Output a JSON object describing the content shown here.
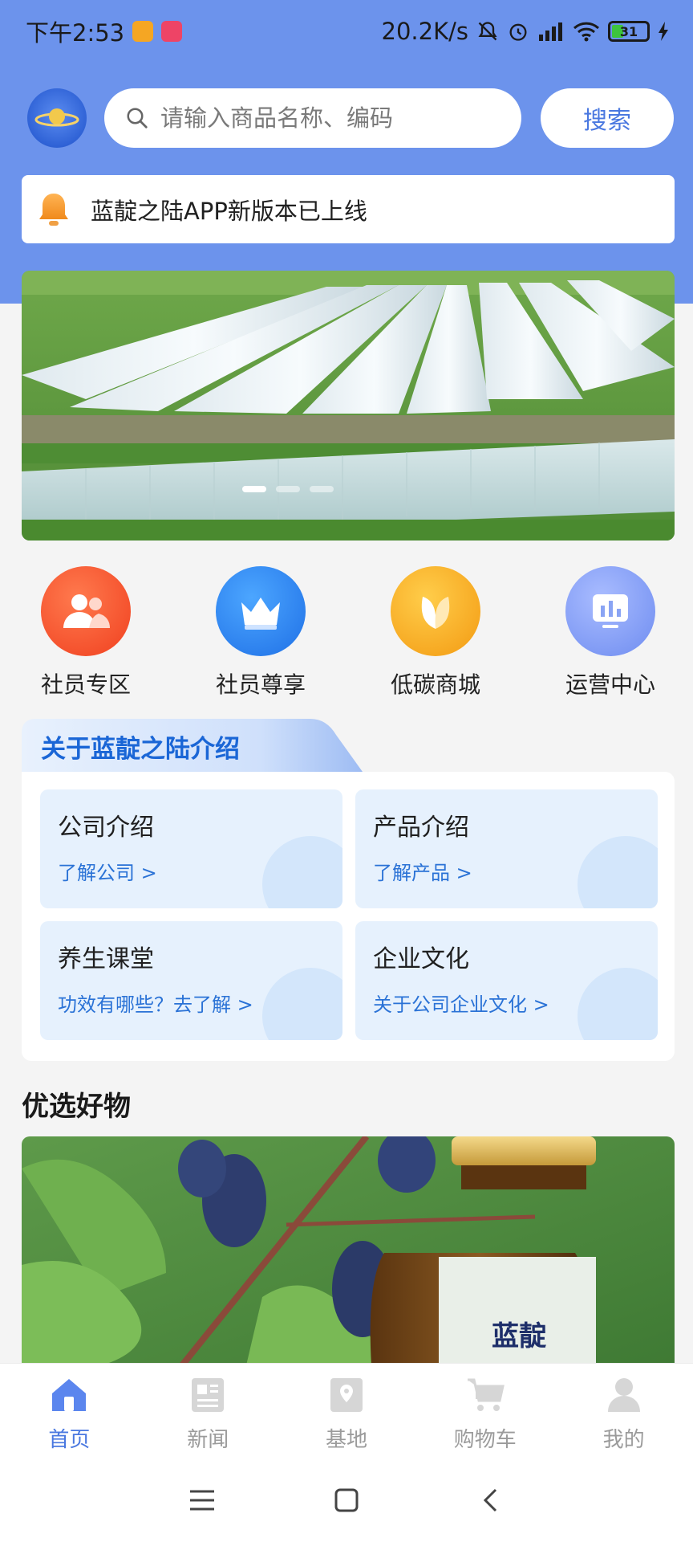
{
  "status_bar": {
    "time": "下午2:53",
    "net_speed": "20.2K/s",
    "battery": "31"
  },
  "header": {
    "search_placeholder": "请输入商品名称、编码",
    "search_button": "搜索"
  },
  "notice": {
    "text": "蓝靛之陆APP新版本已上线"
  },
  "banner": {
    "dots": 3,
    "active_dot": 0
  },
  "quick_entries": [
    {
      "label": "社员专区",
      "icon": "members-icon",
      "color": "#f5502e"
    },
    {
      "label": "社员尊享",
      "icon": "crown-icon",
      "color": "#2f86f0"
    },
    {
      "label": "低碳商城",
      "icon": "leaf-icon",
      "color": "#f6b121"
    },
    {
      "label": "运营中心",
      "icon": "chart-icon",
      "color": "#7e9cf2"
    }
  ],
  "about": {
    "title": "关于蓝靛之陆介绍",
    "cards": [
      {
        "title": "公司介绍",
        "link": "了解公司 >"
      },
      {
        "title": "产品介绍",
        "link": "了解产品 >"
      },
      {
        "title": "养生课堂",
        "link": "功效有哪些？去了解 >"
      },
      {
        "title": "企业文化",
        "link": "关于公司企业文化 >"
      }
    ]
  },
  "featured": {
    "title": "优选好物",
    "bottle_label": "蓝靛"
  },
  "tabbar": {
    "items": [
      {
        "label": "首页",
        "icon": "home-icon",
        "active": true
      },
      {
        "label": "新闻",
        "icon": "news-icon",
        "active": false
      },
      {
        "label": "基地",
        "icon": "location-icon",
        "active": false
      },
      {
        "label": "购物车",
        "icon": "cart-icon",
        "active": false
      },
      {
        "label": "我的",
        "icon": "user-icon",
        "active": false
      }
    ]
  },
  "colors": {
    "header_bg": "#6c93ec",
    "accent": "#4a78e0",
    "link": "#2a72d6",
    "card_bg": "#e6f1fd"
  }
}
